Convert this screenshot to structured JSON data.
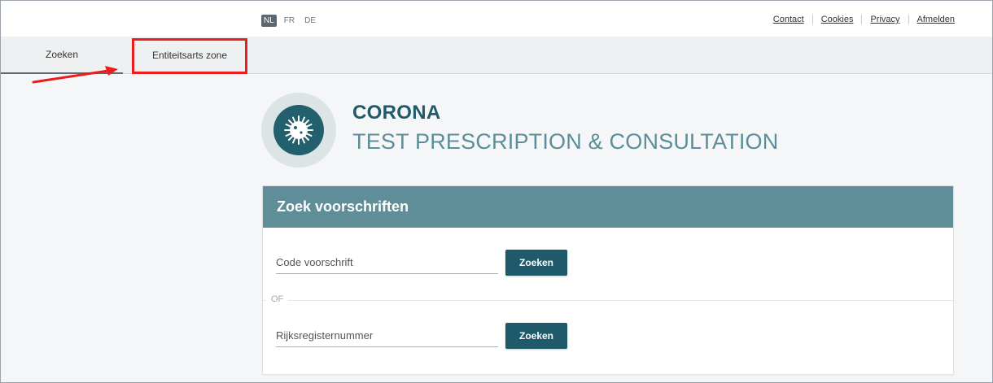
{
  "languages": [
    {
      "code": "NL",
      "active": true
    },
    {
      "code": "FR",
      "active": false
    },
    {
      "code": "DE",
      "active": false
    }
  ],
  "top_links": [
    "Contact",
    "Cookies",
    "Privacy",
    "Afmelden"
  ],
  "tabs": [
    {
      "label": "Zoeken",
      "active": true
    },
    {
      "label": "Entiteitsarts zone",
      "active": false,
      "highlighted": true
    }
  ],
  "hero": {
    "title": "CORONA",
    "subtitle": "TEST PRESCRIPTION & CONSULTATION",
    "logo_icon": "virus-icon"
  },
  "search_card": {
    "title": "Zoek voorschriften",
    "code_field": {
      "placeholder": "Code voorschrift",
      "value": ""
    },
    "code_button": "Zoeken",
    "or_label": "OF",
    "rrn_field": {
      "placeholder": "Rijksregisternummer",
      "value": ""
    },
    "rrn_button": "Zoeken"
  },
  "annotation": {
    "type": "red-box-with-arrow",
    "target": "Entiteitsarts zone",
    "color": "#ea1c1c"
  },
  "colors": {
    "primary": "#1f5a6a",
    "header": "#5f8e99",
    "accent_text": "#5b8e99",
    "annotation": "#ea1c1c"
  }
}
